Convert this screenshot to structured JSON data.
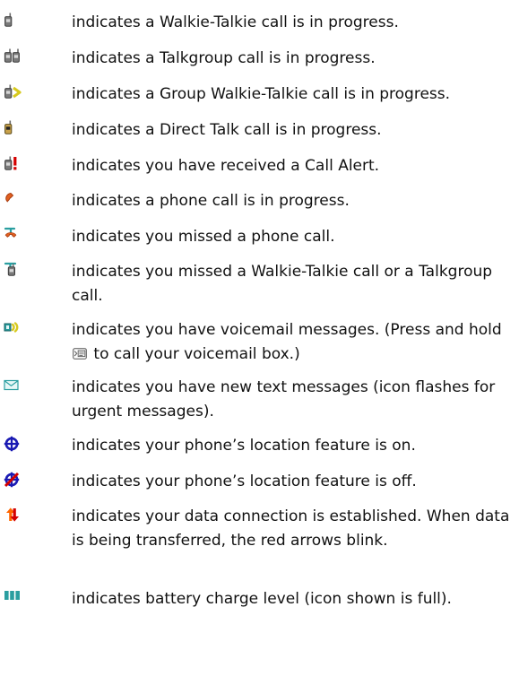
{
  "items": [
    {
      "icon": "walkie-talkie-icon",
      "text": "indicates a Walkie-Talkie call is in progress."
    },
    {
      "icon": "talkgroup-icon",
      "text": "indicates a Talkgroup call is in progress."
    },
    {
      "icon": "group-walkie-talkie-icon",
      "text": "indicates a Group Walkie-Talkie call is in progress."
    },
    {
      "icon": "direct-talk-icon",
      "text": "indicates a Direct Talk call is in progress."
    },
    {
      "icon": "call-alert-icon",
      "text": "indicates you have received a Call Alert."
    },
    {
      "icon": "phone-call-icon",
      "text": "indicates a phone call is in progress."
    },
    {
      "icon": "missed-phone-call-icon",
      "text": "indicates you missed a phone call."
    },
    {
      "icon": "missed-walkie-talkie-icon",
      "text": "indicates you missed a Walkie-Talkie call or a Talkgroup call."
    },
    {
      "icon": "voicemail-icon",
      "text_before": "indicates you have voicemail messages. (Press and hold",
      "text_after": "to call your voicemail box.)",
      "inline_icon": "voicemail-key-icon"
    },
    {
      "icon": "text-message-icon",
      "text": "indicates you have new text messages (icon flashes for urgent messages)."
    },
    {
      "icon": "location-on-icon",
      "text": "indicates your phone’s location feature is on."
    },
    {
      "icon": "location-off-icon",
      "text": "indicates your phone’s location feature is off."
    },
    {
      "icon": "data-connection-icon",
      "text": "indicates your data connection is established. When data is being transferred, the red arrows blink."
    },
    {
      "icon": "battery-level-icon",
      "text": "indicates battery charge level (icon shown is full)."
    }
  ],
  "colors": {
    "text": "#111111",
    "walkie_talkie": "#6b6b6b",
    "direct_talk": "#caa24a",
    "alert_red": "#d40000",
    "phone_orange": "#e06020",
    "voicemail_yellow": "#d7c91e",
    "message_teal": "#2a9ea0",
    "location_blue": "#1a1ab3",
    "data_orange": "#ff6600",
    "battery_teal": "#2a9ea0"
  }
}
